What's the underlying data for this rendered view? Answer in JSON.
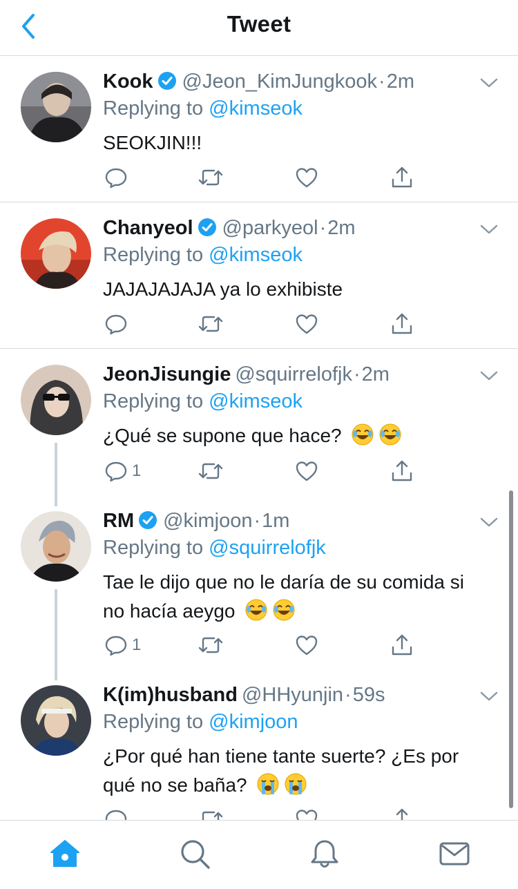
{
  "header": {
    "title": "Tweet",
    "back_icon": "chevron-left-icon"
  },
  "colors": {
    "accent": "#1da1f2",
    "secondary_text": "#657786",
    "primary_text": "#14171a",
    "divider": "#d6d9db"
  },
  "tweets": [
    {
      "name": "Kook",
      "verified": true,
      "handle": "@Jeon_KimJungkook",
      "separator": "·",
      "time": "2m",
      "replying_label": "Replying to",
      "replying_to": "@kimseok",
      "text": "SEOKJIN!!!",
      "reply_count": ""
    },
    {
      "name": "Chanyeol",
      "verified": true,
      "handle": "@parkyeol",
      "separator": "·",
      "time": "2m",
      "replying_label": "Replying to",
      "replying_to": "@kimseok",
      "text": "JAJAJAJAJA ya lo exhibiste",
      "reply_count": ""
    },
    {
      "name": "JeonJisungie",
      "verified": false,
      "handle": "@squirrelofjk",
      "separator": "·",
      "time": "2m",
      "replying_label": "Replying to",
      "replying_to": "@kimseok",
      "text": "¿Qué se supone que hace?",
      "emoji": "face-with-tears-of-joy x2",
      "reply_count": "1"
    },
    {
      "name": "RM",
      "verified": true,
      "handle": "@kimjoon",
      "separator": "·",
      "time": "1m",
      "replying_label": "Replying to",
      "replying_to": "@squirrelofjk",
      "text_line1": "Tae le dijo que no le daría de su comida si",
      "text_line2": "no hacía aeygo",
      "emoji": "face-with-tears-of-joy x2",
      "reply_count": "1"
    },
    {
      "name": "K(im)husband",
      "verified": false,
      "handle": "@HHyunjin",
      "separator": "·",
      "time": "59s",
      "replying_label": "Replying to",
      "replying_to": "@kimjoon",
      "text_line1": "¿Por qué han tiene tante suerte? ¿Es por",
      "text_line2": "qué no se baña?",
      "emoji": "loudly-crying-face x2",
      "reply_count": ""
    }
  ],
  "tabbar": {
    "items": [
      "home-icon",
      "search-icon",
      "notifications-icon",
      "messages-icon"
    ],
    "active": "home-icon"
  }
}
